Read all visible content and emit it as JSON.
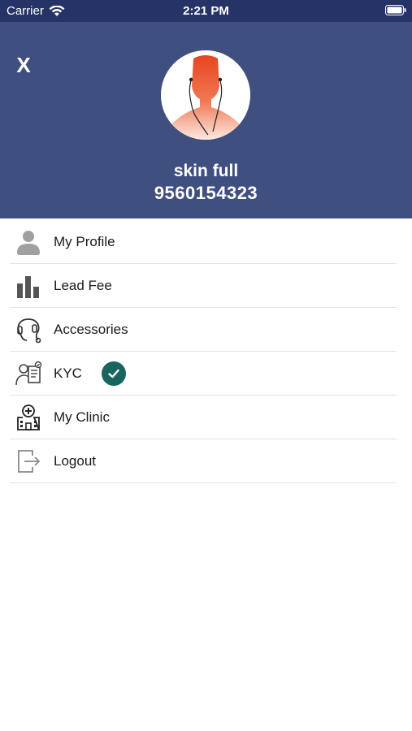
{
  "status_bar": {
    "carrier": "Carrier",
    "time": "2:21 PM",
    "wifi_icon": "wifi-icon",
    "battery_icon": "battery-icon"
  },
  "header": {
    "close_label": "X",
    "avatar_icon": "user-avatar-headphones",
    "name": "skin full",
    "phone": "9560154323"
  },
  "menu": {
    "items": [
      {
        "label": "My Profile",
        "icon": "person-icon"
      },
      {
        "label": "Lead Fee",
        "icon": "bar-chart-icon"
      },
      {
        "label": "Accessories",
        "icon": "hearing-aid-icon"
      },
      {
        "label": "KYC",
        "icon": "kyc-document-icon",
        "verified": true,
        "verified_icon": "check-circle-icon"
      },
      {
        "label": "My Clinic",
        "icon": "clinic-icon"
      },
      {
        "label": "Logout",
        "icon": "logout-icon"
      }
    ]
  },
  "colors": {
    "status_bar_bg": "#263366",
    "header_bg": "#3f4f80",
    "verified_badge": "#16655e",
    "avatar_accent": "#e8441f"
  }
}
